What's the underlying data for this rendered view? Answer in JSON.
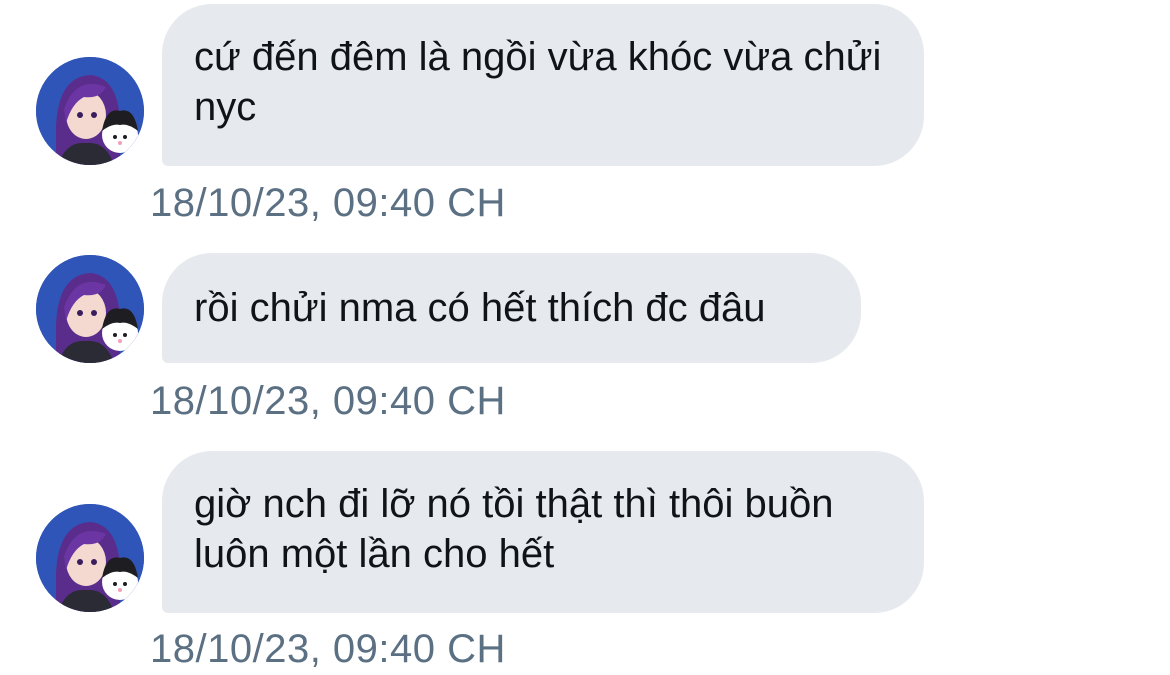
{
  "messages": [
    {
      "text": "cứ đến đêm là ngồi vừa khóc vừa chửi nyc",
      "timestamp": "18/10/23, 09:40 CH",
      "avatar_icon": "anime-character-with-kuromi-avatar"
    },
    {
      "text": "rồi chửi nma có hết thích đc đâu",
      "timestamp": "18/10/23, 09:40 CH",
      "avatar_icon": "anime-character-with-kuromi-avatar"
    },
    {
      "text": "giờ nch đi lỡ nó tồi thật thì thôi buồn luôn một lần cho hết",
      "timestamp": "18/10/23, 09:40 CH",
      "avatar_icon": "anime-character-with-kuromi-avatar"
    }
  ],
  "colors": {
    "bubble_bg": "#e6e9ee",
    "message_text": "#0f1419",
    "timestamp_text": "#5b7083",
    "avatar_bg": "#2d4fb0"
  }
}
